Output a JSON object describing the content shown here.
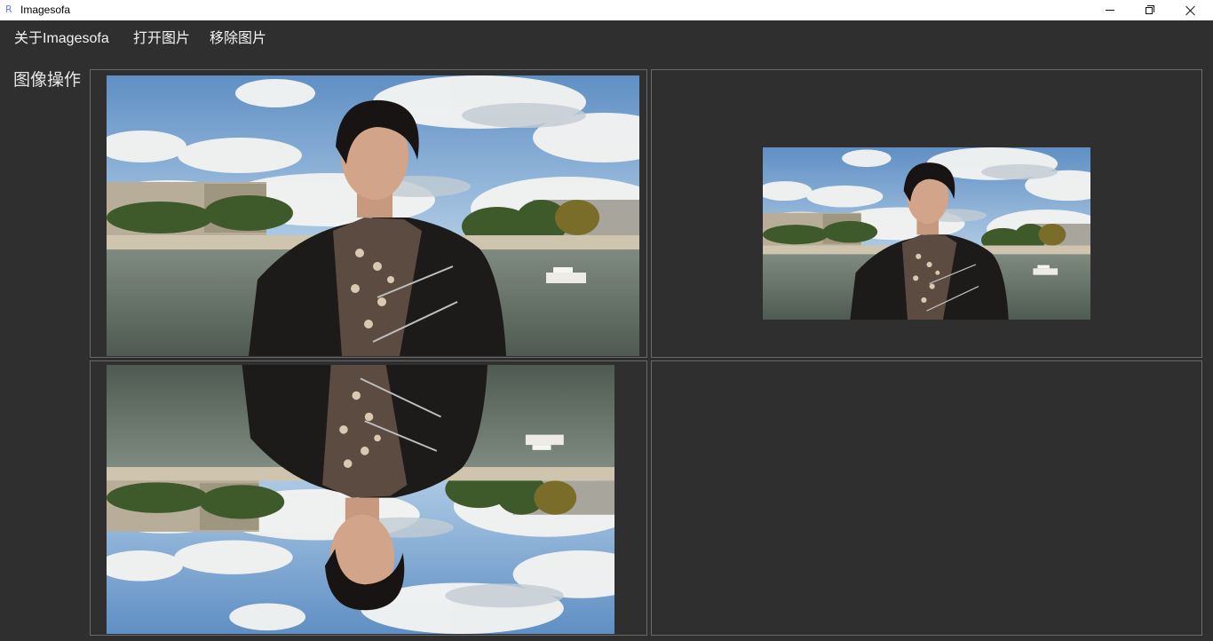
{
  "window": {
    "app_icon_glyph": "R",
    "title": "Imagesofa",
    "controls": {
      "minimize_icon": "minimize-icon",
      "maximize_icon": "restore-icon",
      "close_icon": "close-icon"
    }
  },
  "menu": {
    "items": [
      {
        "label": "关于Imagesofa"
      },
      {
        "label": "打开图片"
      },
      {
        "label": "移除图片"
      }
    ]
  },
  "section": {
    "label": "图像操作"
  },
  "panels": [
    {
      "position": "top-left",
      "content": "original",
      "image": "photo-man-on-river"
    },
    {
      "position": "top-right",
      "content": "scaled",
      "image": "photo-man-on-river"
    },
    {
      "position": "bottom-left",
      "content": "flipped-vertically",
      "image": "photo-man-on-river"
    },
    {
      "position": "bottom-right",
      "content": "empty"
    }
  ],
  "colors": {
    "background": "#2f2f2f",
    "panel_border": "#6a6a6a",
    "menu_text": "#f2f2f2",
    "titlebar": "#ffffff"
  }
}
